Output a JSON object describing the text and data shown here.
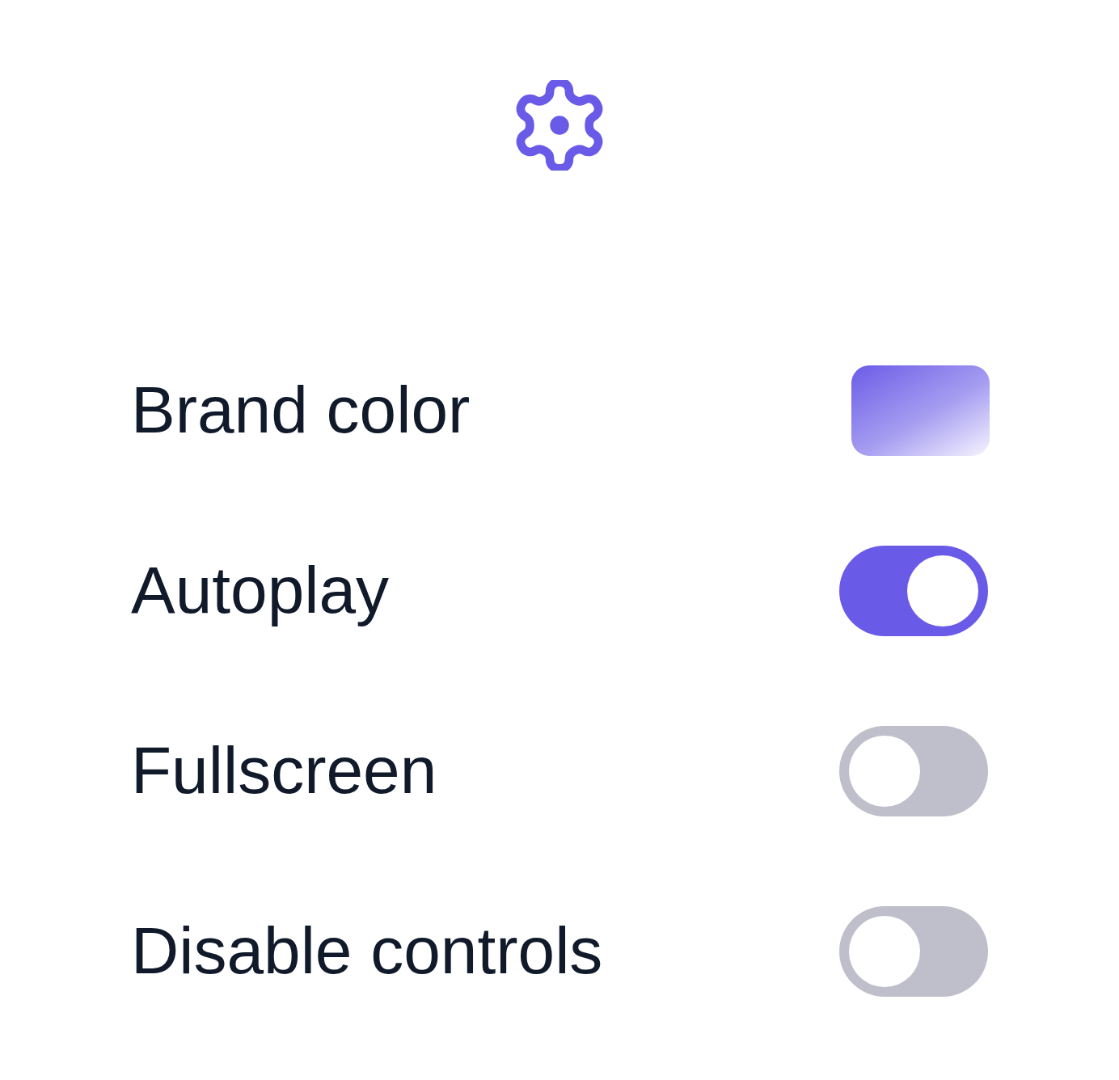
{
  "rows": [
    {
      "label": "Brand color",
      "kind": "color",
      "color": "#6b5ce7"
    },
    {
      "label": "Autoplay",
      "kind": "toggle",
      "on": true
    },
    {
      "label": "Fullscreen",
      "kind": "toggle",
      "on": false
    },
    {
      "label": "Disable controls",
      "kind": "toggle",
      "on": false
    }
  ]
}
